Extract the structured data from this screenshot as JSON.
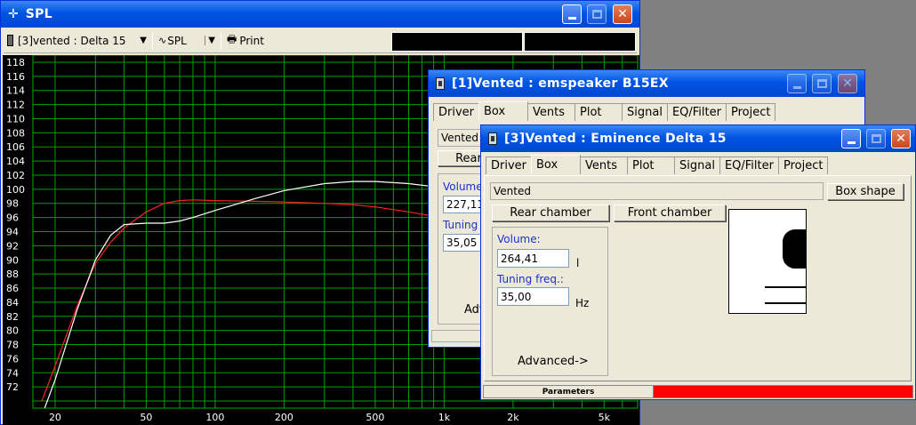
{
  "spl_window": {
    "title": "SPL",
    "driver_select": "[3]vented : Delta 15",
    "view_select": "SPL",
    "print_label": "Print",
    "y_ticks": [
      "118",
      "116",
      "114",
      "112",
      "110",
      "108",
      "106",
      "104",
      "102",
      "100",
      "98",
      "96",
      "94",
      "92",
      "90",
      "88",
      "86",
      "84",
      "82",
      "80",
      "78",
      "76",
      "74",
      "72"
    ],
    "x_ticks": [
      "20",
      "50",
      "100",
      "200",
      "500",
      "1k",
      "2k",
      "5k"
    ]
  },
  "chart_data": {
    "type": "line",
    "xscale": "log",
    "xlim": [
      16,
      7000
    ],
    "ylim": [
      69,
      119
    ],
    "grid": true,
    "series": [
      {
        "color": "#ff2020",
        "x": [
          17.5,
          20,
          25,
          30,
          35,
          40,
          50,
          60,
          70,
          80,
          100,
          150,
          200,
          300,
          400,
          500,
          700,
          1000,
          1500
        ],
        "y": [
          70,
          75,
          83.5,
          89.5,
          92.5,
          94.5,
          96.8,
          98,
          98.4,
          98.5,
          98.4,
          98.3,
          98.2,
          98,
          97.8,
          97.5,
          96.8,
          95.9,
          95
        ]
      },
      {
        "color": "#ffffff",
        "x": [
          18,
          20,
          25,
          30,
          35,
          40,
          50,
          60,
          70,
          80,
          100,
          150,
          200,
          300,
          400,
          500,
          700,
          1000,
          1500
        ],
        "y": [
          69,
          73,
          83,
          90,
          93.5,
          95,
          95.2,
          95.2,
          95.5,
          96,
          97,
          98.7,
          99.8,
          100.8,
          101.1,
          101.1,
          100.8,
          100.2,
          99.6
        ]
      }
    ]
  },
  "win1": {
    "title": "[1]Vented : emspeaker B15EX",
    "tabs": [
      "Driver",
      "Box",
      "Vents",
      "Plot",
      "Signal",
      "EQ/Filter",
      "Project"
    ],
    "box_type": "Vented",
    "rear_button": "Rear",
    "volume_label": "Volume",
    "volume_value": "227,11",
    "tuning_label": "Tuning",
    "tuning_value": "35,05",
    "advanced_label": "Adv"
  },
  "win3": {
    "title": "[3]Vented : Eminence  Delta 15",
    "tabs": [
      "Driver",
      "Box",
      "Vents",
      "Plot",
      "Signal",
      "EQ/Filter",
      "Project"
    ],
    "box_type": "Vented",
    "box_shape_button": "Box shape",
    "rear_chamber_button": "Rear chamber",
    "front_chamber_button": "Front chamber",
    "volume_label": "Volume:",
    "volume_value": "264,41",
    "volume_unit": "l",
    "tuning_label": "Tuning freq.:",
    "tuning_value": "35,00",
    "tuning_unit": "Hz",
    "advanced_label": "Advanced->",
    "parameters_label": "Parameters",
    "status_color": "#ff0000"
  }
}
